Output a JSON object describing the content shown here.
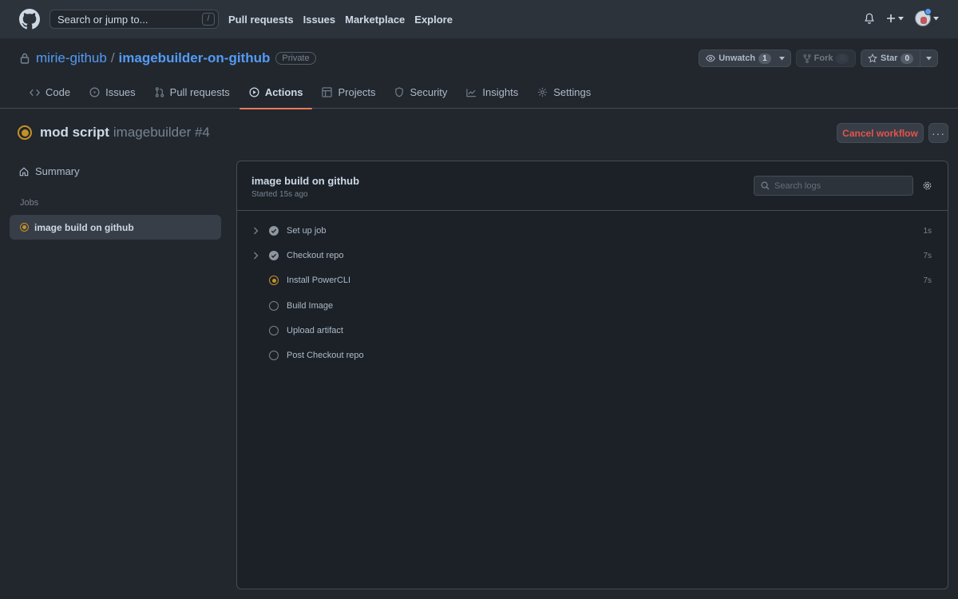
{
  "topbar": {
    "search_placeholder": "Search or jump to...",
    "search_shortcut": "/",
    "nav": [
      "Pull requests",
      "Issues",
      "Marketplace",
      "Explore"
    ]
  },
  "repo": {
    "owner": "mirie-github",
    "separator": "/",
    "name": "imagebuilder-on-github",
    "visibility": "Private",
    "unwatch_label": "Unwatch",
    "watch_count": "1",
    "fork_label": "Fork",
    "fork_count": "0",
    "star_label": "Star",
    "star_count": "0",
    "tabs": [
      {
        "label": "Code",
        "icon": "code-icon"
      },
      {
        "label": "Issues",
        "icon": "issue-icon"
      },
      {
        "label": "Pull requests",
        "icon": "pull-request-icon"
      },
      {
        "label": "Actions",
        "icon": "play-icon",
        "active": true
      },
      {
        "label": "Projects",
        "icon": "table-icon"
      },
      {
        "label": "Security",
        "icon": "shield-icon"
      },
      {
        "label": "Insights",
        "icon": "graph-icon"
      },
      {
        "label": "Settings",
        "icon": "gear-icon"
      }
    ]
  },
  "run": {
    "commit_title": "mod script",
    "workflow_name": "imagebuilder #4",
    "status": "in_progress",
    "cancel_label": "Cancel workflow",
    "more_label": "···"
  },
  "sidebar": {
    "summary_label": "Summary",
    "jobs_label": "Jobs",
    "jobs": [
      {
        "label": "image build on github",
        "status": "in_progress"
      }
    ]
  },
  "job": {
    "title": "image build on github",
    "started": "Started 15s ago",
    "search_placeholder": "Search logs",
    "steps": [
      {
        "name": "Set up job",
        "status": "success",
        "duration": "1s",
        "expandable": true
      },
      {
        "name": "Checkout repo",
        "status": "success",
        "duration": "7s",
        "expandable": true
      },
      {
        "name": "Install PowerCLI",
        "status": "in_progress",
        "duration": "7s",
        "expandable": false
      },
      {
        "name": "Build Image",
        "status": "pending",
        "duration": "",
        "expandable": false
      },
      {
        "name": "Upload artifact",
        "status": "pending",
        "duration": "",
        "expandable": false
      },
      {
        "name": "Post Checkout repo",
        "status": "pending",
        "duration": "",
        "expandable": false
      }
    ]
  },
  "colors": {
    "background": "#22272e",
    "header": "#2d333b",
    "accent_link": "#539bf5",
    "in_progress": "#c69026",
    "danger": "#e5534b",
    "active_tab_underline": "#ec775c"
  }
}
